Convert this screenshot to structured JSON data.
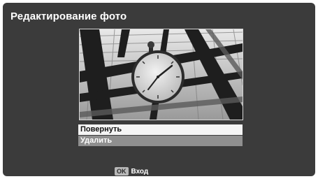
{
  "screen": {
    "title": "Редактирование фото"
  },
  "photo": {
    "description_icon": "photo-thumbnail"
  },
  "menu": {
    "items": [
      {
        "label": "Повернуть",
        "state": "selected"
      },
      {
        "label": "Удалить",
        "state": "normal"
      }
    ]
  },
  "footer": {
    "ok_key": "OK",
    "ok_label": "Вход"
  },
  "colors": {
    "background": "#3b3b3b",
    "selected_item": "#f4f4f4",
    "normal_item": "#8f8f8f"
  }
}
